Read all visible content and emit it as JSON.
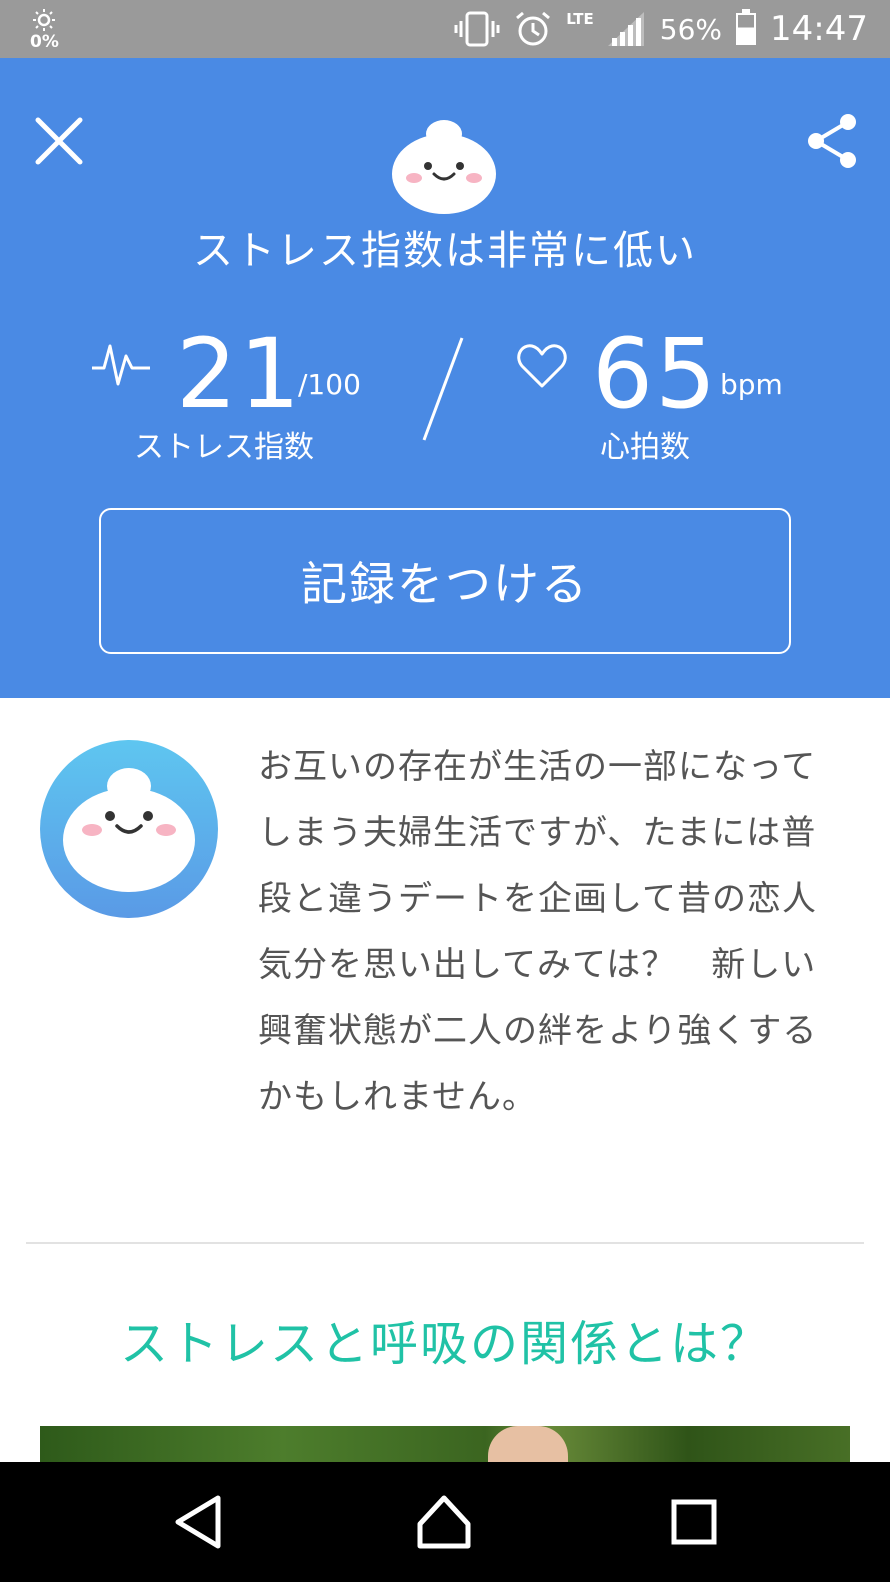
{
  "status_bar": {
    "left_percent": "0%",
    "battery_percent": "56%",
    "network": "LTE",
    "time": "14:47"
  },
  "header": {
    "background_color": "#4a8ae4",
    "headline": "ストレス指数は非常に低い",
    "stress": {
      "value": "21",
      "unit": "/100",
      "label": "ストレス指数"
    },
    "heart": {
      "value": "65",
      "unit": "bpm",
      "label": "心拍数"
    },
    "record_button_label": "記録をつける",
    "close_icon": "close-icon",
    "share_icon": "share-icon"
  },
  "advice": {
    "text": "お互いの存在が生活の一部になって\nしまう夫婦生活ですが、たまには普\n段と違うデートを企画して昔の恋人\n気分を思い出してみては？　新しい\n興奮状態が二人の絆をより強くする\nかもしれません。"
  },
  "section": {
    "title": "ストレスと呼吸の関係とは？",
    "title_color": "#20c2a6"
  },
  "nav": {
    "back_icon": "back-triangle-icon",
    "home_icon": "home-icon",
    "recent_icon": "recent-apps-icon"
  }
}
